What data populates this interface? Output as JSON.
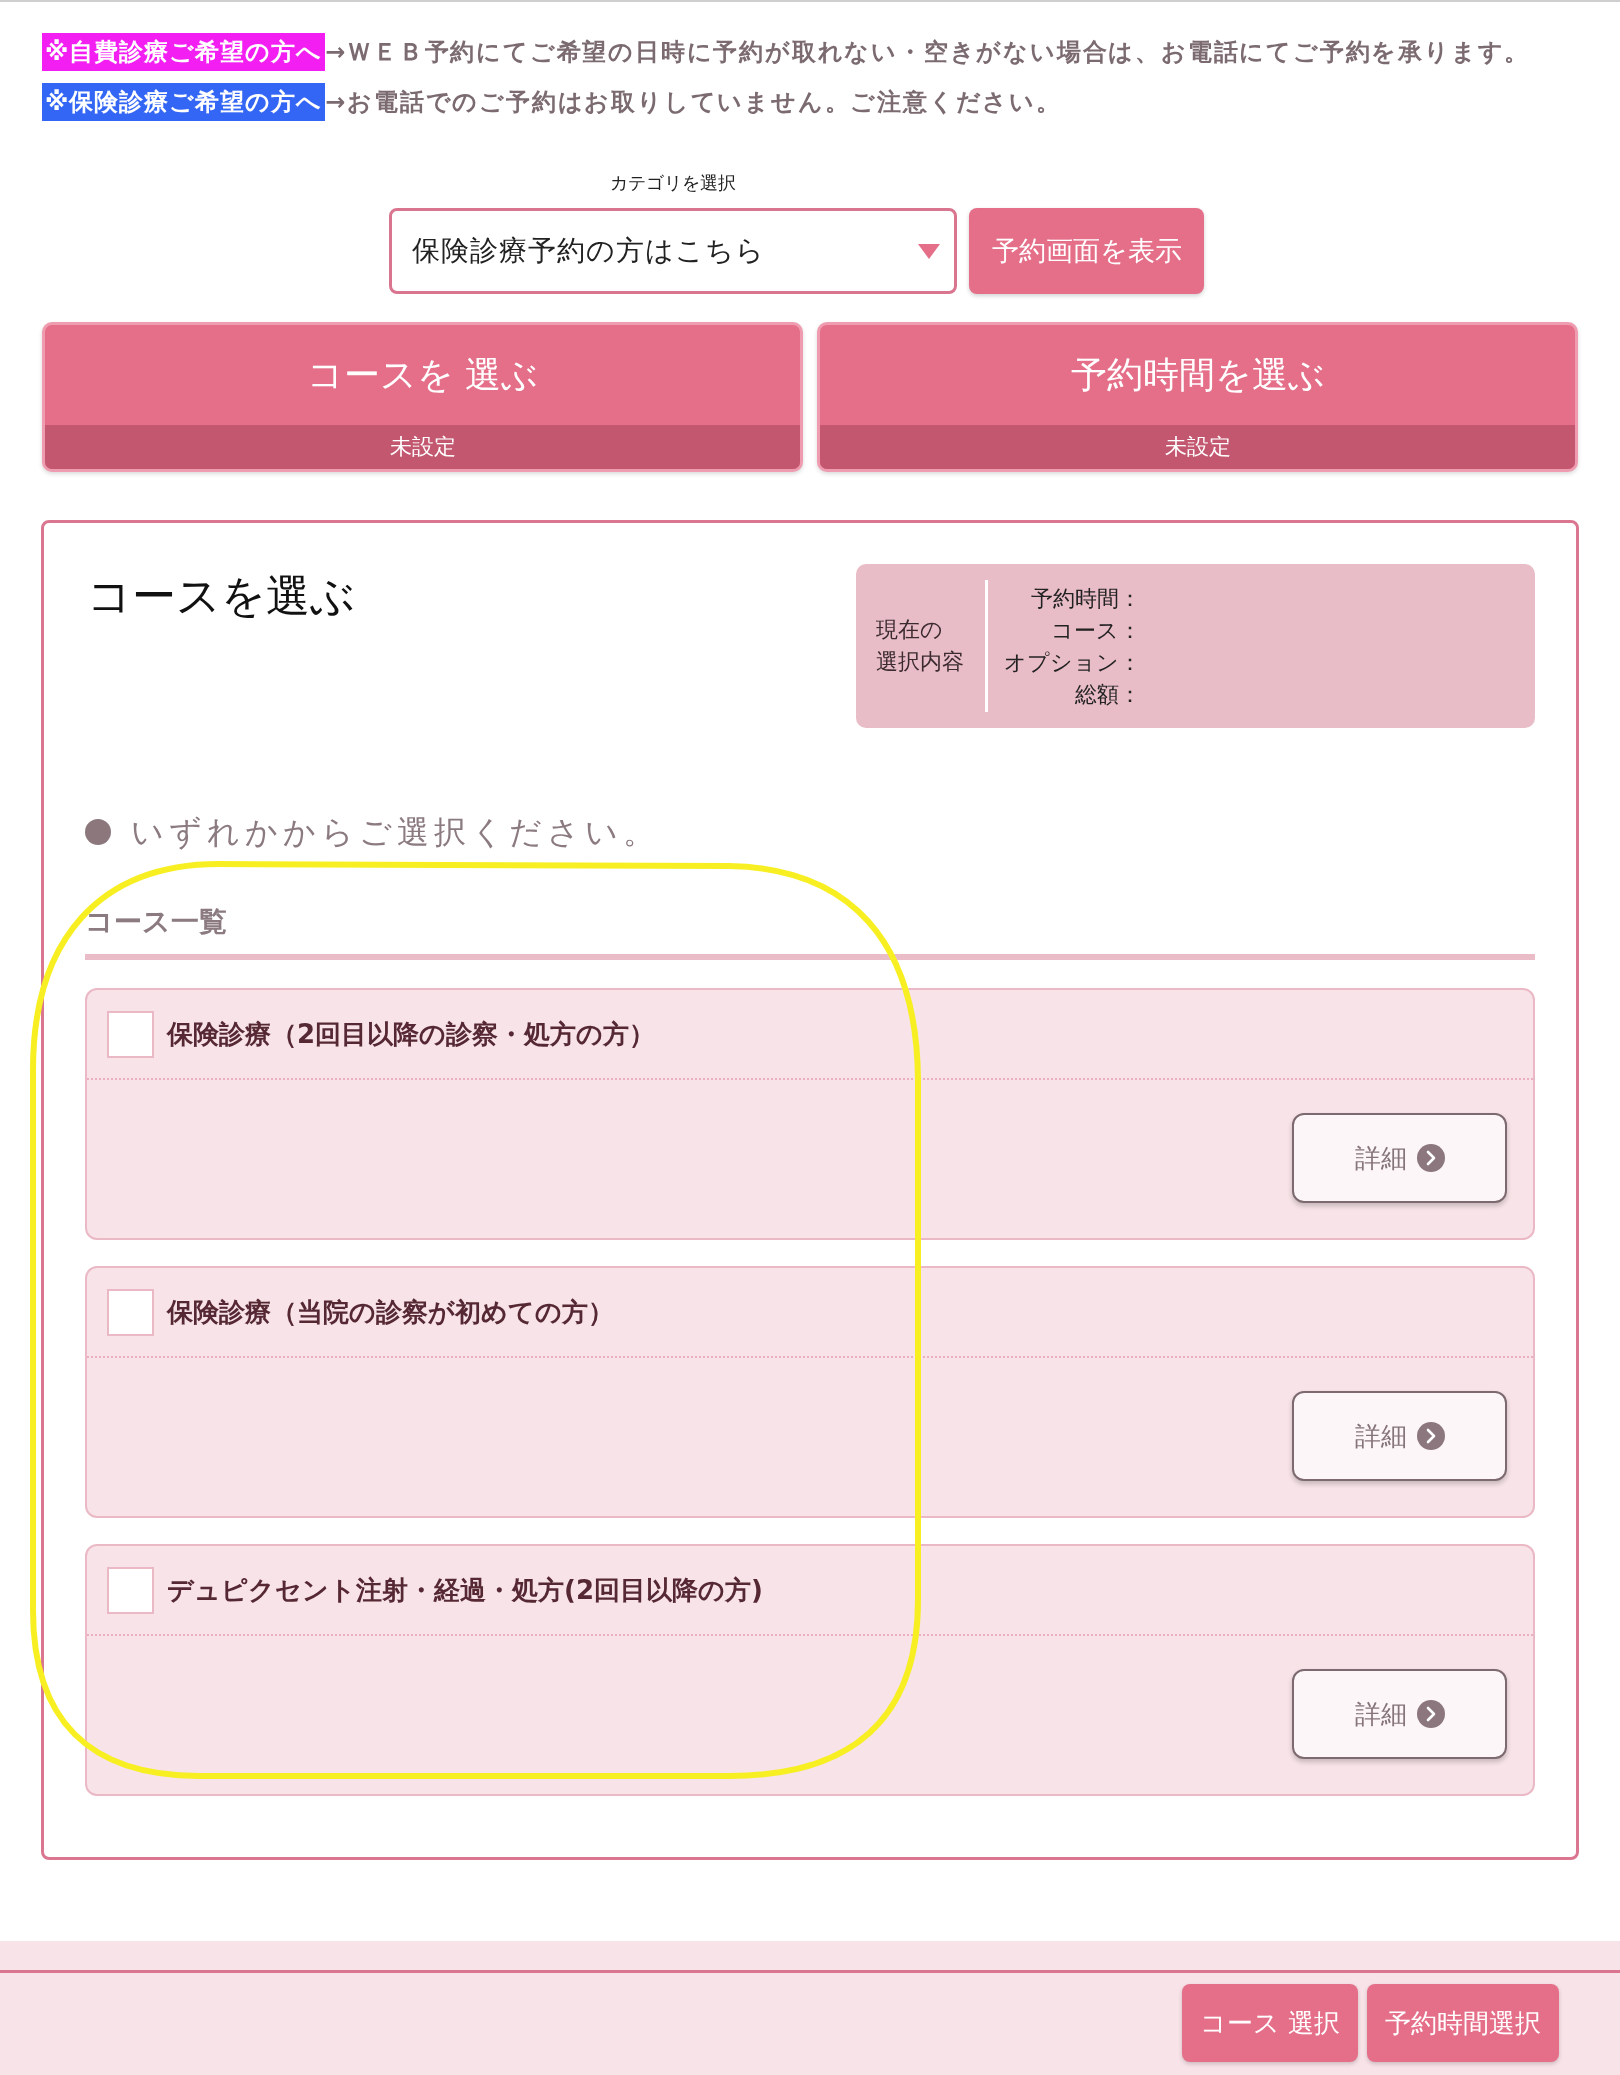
{
  "notices": [
    {
      "label": "※自費診療ご希望の方へ",
      "color": "#f21ef2",
      "text": "→ＷＥＢ予約にてご希望の日時に予約が取れない・空きがない場合は、お電話にてご予約を承ります。"
    },
    {
      "label": "※保険診療ご希望の方へ",
      "color": "#3366f4",
      "text": "→お電話でのご予約はお取りしていません。ご注意ください。"
    }
  ],
  "category": {
    "label": "カテゴリを選択",
    "value": "保険診療予約の方はこちら",
    "button": "予約画面を表示"
  },
  "steps": [
    {
      "title": "コースを 選ぶ",
      "status": "未設定"
    },
    {
      "title": "予約時間を選ぶ",
      "status": "未設定"
    }
  ],
  "panel": {
    "title": "コースを選ぶ",
    "summary": {
      "heading_lines": [
        "現在の",
        "選択内容"
      ],
      "labels": [
        "予約時間：",
        "コース：",
        "オプション：",
        "総額："
      ]
    },
    "instruction": "いずれかからご選択ください。",
    "list_heading": "コース一覧",
    "courses": [
      {
        "name": "保険診療（2回目以降の診察・処方の方）",
        "checked": false,
        "detail": "詳細"
      },
      {
        "name": "保険診療（当院の診察が初めての方）",
        "checked": false,
        "detail": "詳細"
      },
      {
        "name": "デュピクセント注射・経過・処方(2回目以降の方)",
        "checked": false,
        "detail": "詳細"
      }
    ]
  },
  "footer": {
    "buttons": [
      "コース 選択",
      "予約時間選択"
    ]
  }
}
